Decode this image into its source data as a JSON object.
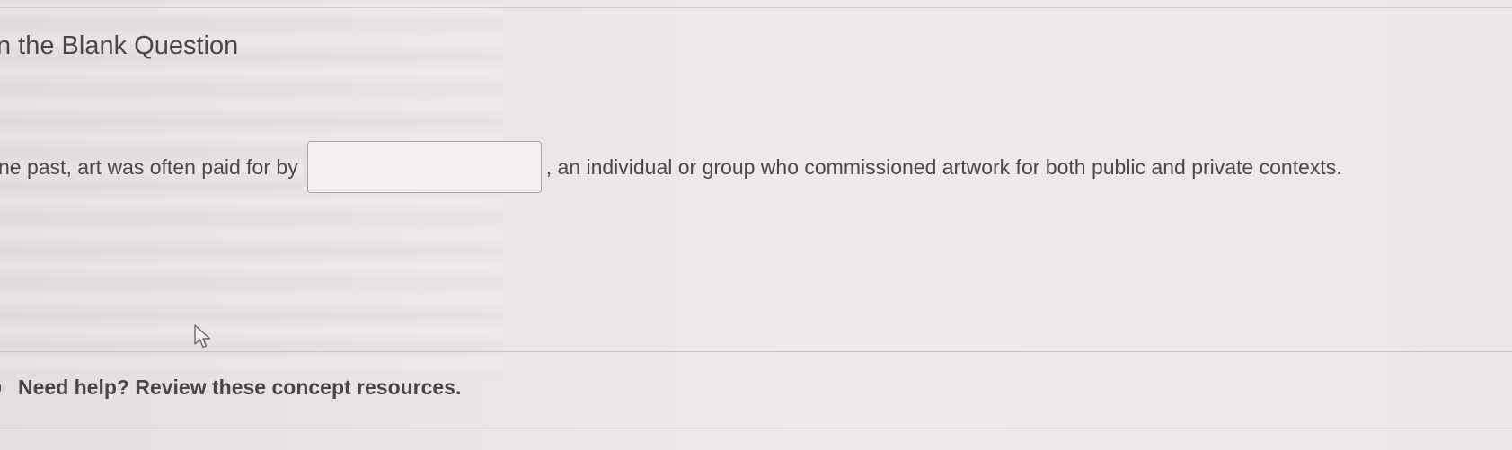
{
  "page": {
    "title": "n the Blank Question"
  },
  "question": {
    "text_before": "ne past, art was often paid for by",
    "blank_value": "",
    "text_after": ", an individual or group who commissioned artwork for both public and private contexts."
  },
  "help": {
    "label": "Need help? Review these concept resources.",
    "icon": "help-circle-icon"
  },
  "pointer": {
    "icon": "mouse-pointer-icon"
  }
}
